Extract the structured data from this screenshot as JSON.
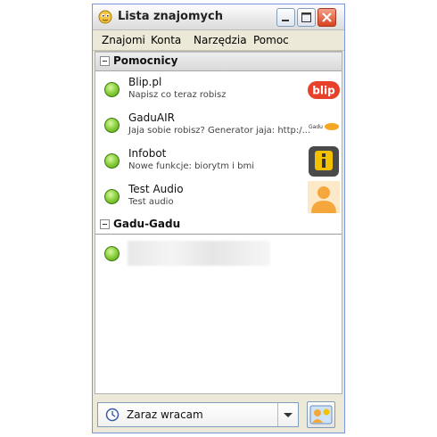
{
  "window": {
    "title": "Lista znajomych"
  },
  "menu": [
    "Znajomi",
    "Konta",
    "Narzędzia",
    "Pomoc"
  ],
  "groups": [
    {
      "name": "Pomocnicy",
      "contacts": [
        {
          "name": "Blip.pl",
          "description": "Napisz co teraz robisz",
          "avatar": "blip-logo"
        },
        {
          "name": "GaduAIR",
          "description": "Jaja sobie robisz? Generator jaja: http:/...",
          "avatar": "gaduair-logo"
        },
        {
          "name": "Infobot",
          "description": "Nowe funkcje: biorytm i bmi",
          "avatar": "info-icon"
        },
        {
          "name": "Test Audio",
          "description": "Test audio",
          "avatar": "person-silhouette"
        }
      ]
    },
    {
      "name": "Gadu-Gadu",
      "contacts": [
        {
          "name": "",
          "description": "",
          "avatar": ""
        }
      ]
    }
  ],
  "status": {
    "label": "Zaraz wracam",
    "icon": "clock-icon"
  },
  "colors": {
    "online": "#8fd43f",
    "close_button": "#d8421f",
    "blip_brand": "#e8412a",
    "info_accent": "#f2c200"
  }
}
